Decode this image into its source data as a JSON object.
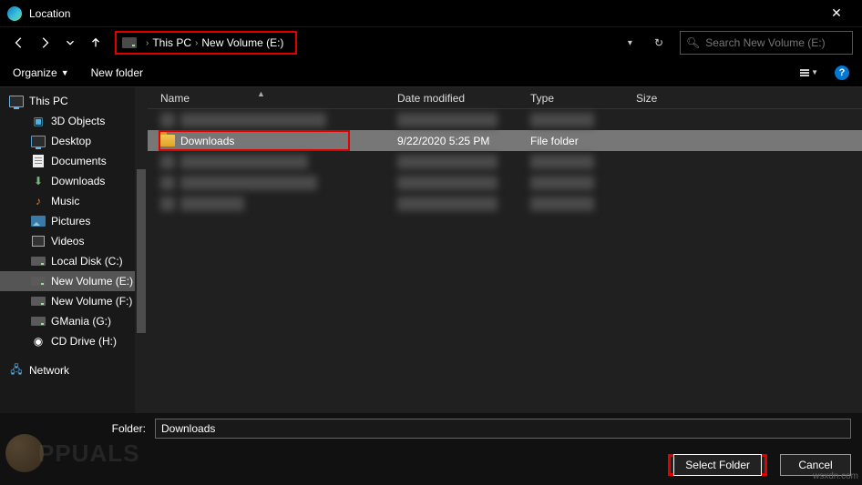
{
  "window": {
    "title": "Location"
  },
  "nav": {
    "breadcrumb": [
      "This PC",
      "New Volume (E:)"
    ]
  },
  "search": {
    "placeholder": "Search New Volume (E:)"
  },
  "toolbar": {
    "organize": "Organize",
    "newfolder": "New folder"
  },
  "tree": {
    "root": "This PC",
    "items": [
      "3D Objects",
      "Desktop",
      "Documents",
      "Downloads",
      "Music",
      "Pictures",
      "Videos",
      "Local Disk (C:)",
      "New Volume (E:)",
      "New Volume (F:)",
      "GMania (G:)",
      "CD Drive (H:)"
    ],
    "network": "Network"
  },
  "columns": {
    "name": "Name",
    "date": "Date modified",
    "type": "Type",
    "size": "Size"
  },
  "rows": {
    "selected": {
      "name": "Downloads",
      "date": "9/22/2020 5:25 PM",
      "type": "File folder"
    }
  },
  "footer": {
    "label": "Folder:",
    "value": "Downloads",
    "select": "Select Folder",
    "cancel": "Cancel"
  },
  "watermark": "PPUALS",
  "watermark2": "wsxdn.com"
}
